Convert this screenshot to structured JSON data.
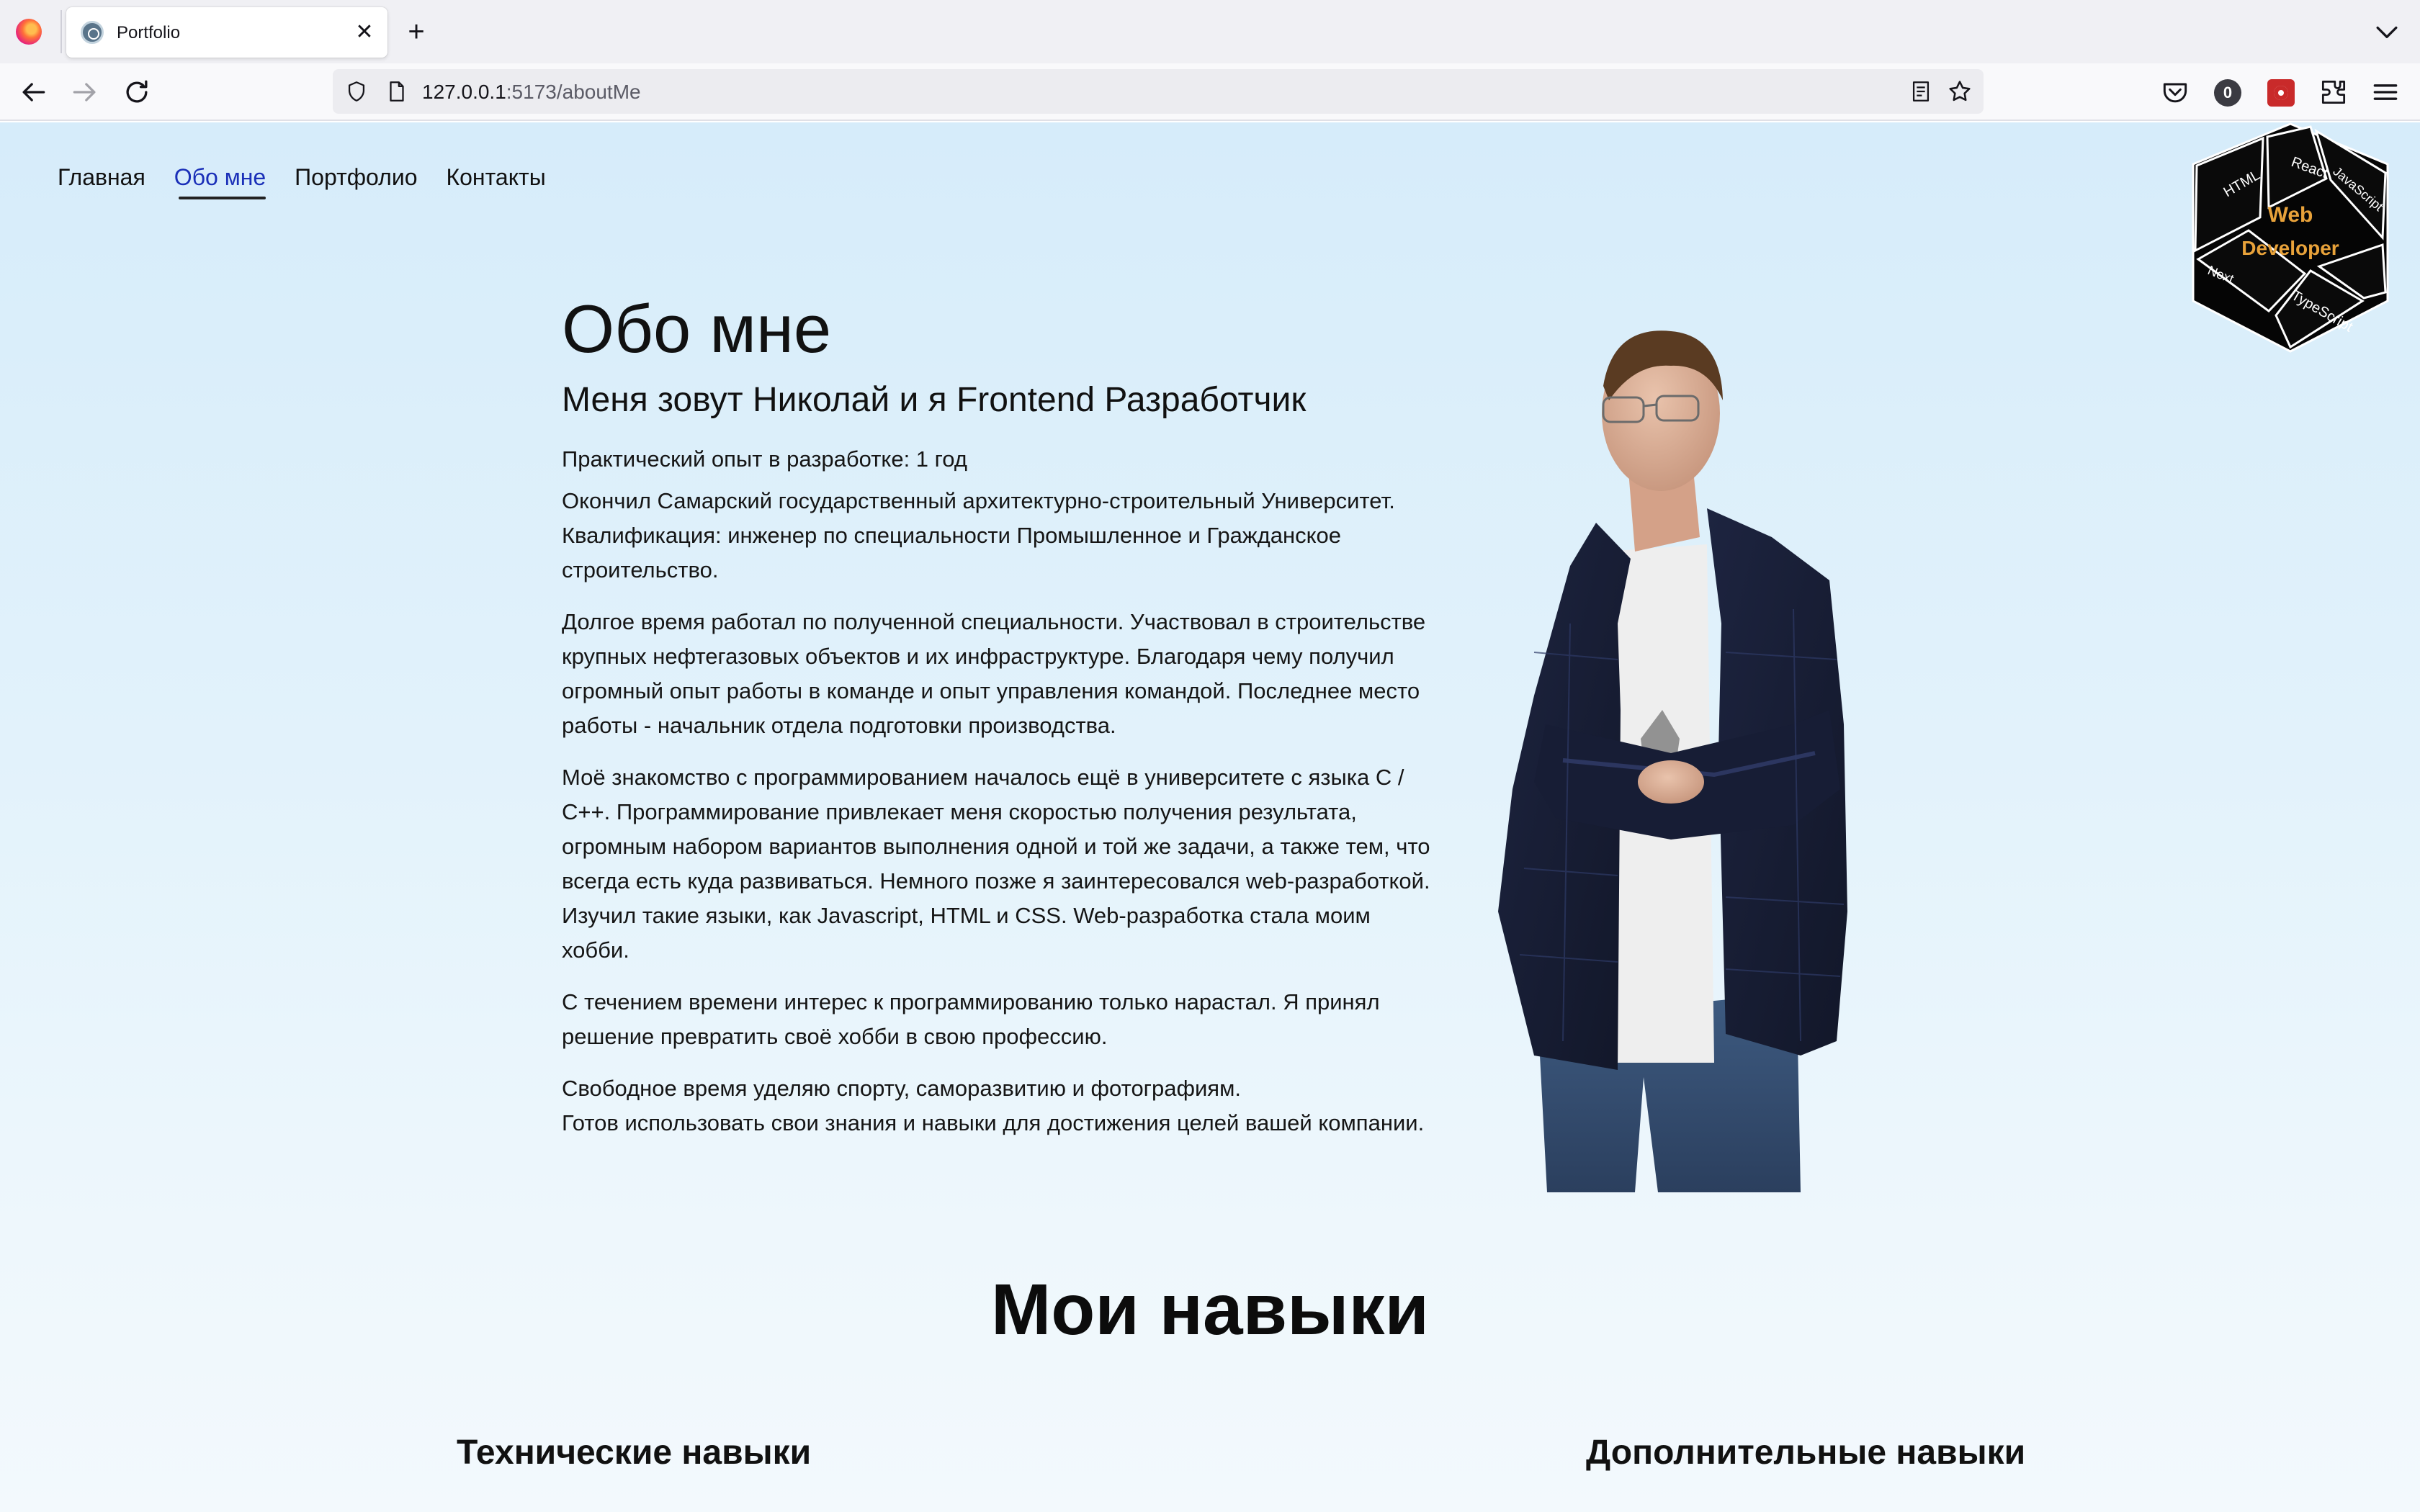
{
  "browser": {
    "tab_title": "Portfolio",
    "url_host": "127.0.0.1",
    "url_rest": ":5173/aboutMe",
    "extension_badge": "0"
  },
  "icons": [
    "firefox-logo-icon",
    "tab-favicon-icon",
    "close-icon",
    "plus-icon",
    "chevron-down-icon",
    "back-arrow-icon",
    "forward-arrow-icon",
    "reload-icon",
    "shield-icon",
    "page-icon",
    "reader-view-icon",
    "star-icon",
    "pocket-icon",
    "extension-badge-icon",
    "extension-red-icon",
    "extensions-puzzle-icon",
    "hamburger-menu-icon"
  ],
  "site_nav": [
    {
      "label": "Главная",
      "active": false
    },
    {
      "label": "Обо мне",
      "active": true
    },
    {
      "label": "Портфолио",
      "active": false
    },
    {
      "label": "Контакты",
      "active": false
    }
  ],
  "logo": {
    "line1": "Web",
    "line2": "Developer",
    "faces": [
      "HTML",
      "React",
      "JavaScript",
      "TypeScript",
      "Next"
    ]
  },
  "about": {
    "title": "Обо мне",
    "subtitle": "Меня зовут Николай и я Frontend Разработчик",
    "experience": "Практический опыт в разработке: 1 год",
    "education": "Окончил Самарский государственный архитектурно-строительный Университет. Квалификация: инженер по специальности Промышленное и Гражданское строительство.",
    "career": "Долгое время работал по полученной специальности. Участвовал в строительстве крупных нефтегазовых объектов и их инфраструктуре. Благодаря чему получил огромный опыт работы в команде и опыт управления командой. Последнее место работы - начальник отдела подготовки производства.",
    "programming": "Моё знакомство с программированием началось ещё в университете с языка C / C++. Программирование привлекает меня скоростью получения результата, огромным набором вариантов выполнения одной и той же задачи, а также тем, что всегда есть куда развиваться. Немного позже я заинтересовался web-разработкой. Изучил такие языки, как Javascript, HTML и CSS. Web-разработка стала моим хобби.",
    "decision": "С течением времени интерес к программированию только нарастал. Я принял решение превратить своё хобби в свою профессию.",
    "free_time": "Свободное время уделяю спорту, саморазвитию и фотографиям.",
    "ready": "Готов использовать свои знания и навыки для достижения целей вашей компании."
  },
  "skills": {
    "title": "Мои навыки",
    "technical": "Технические навыки",
    "additional": "Дополнительные навыки"
  },
  "colors": {
    "active_nav": "#1a2fb8",
    "logo_text": "#e8a23a",
    "page_gradient_top": "#d6ecfa",
    "page_gradient_bottom": "#f3f9fd"
  }
}
